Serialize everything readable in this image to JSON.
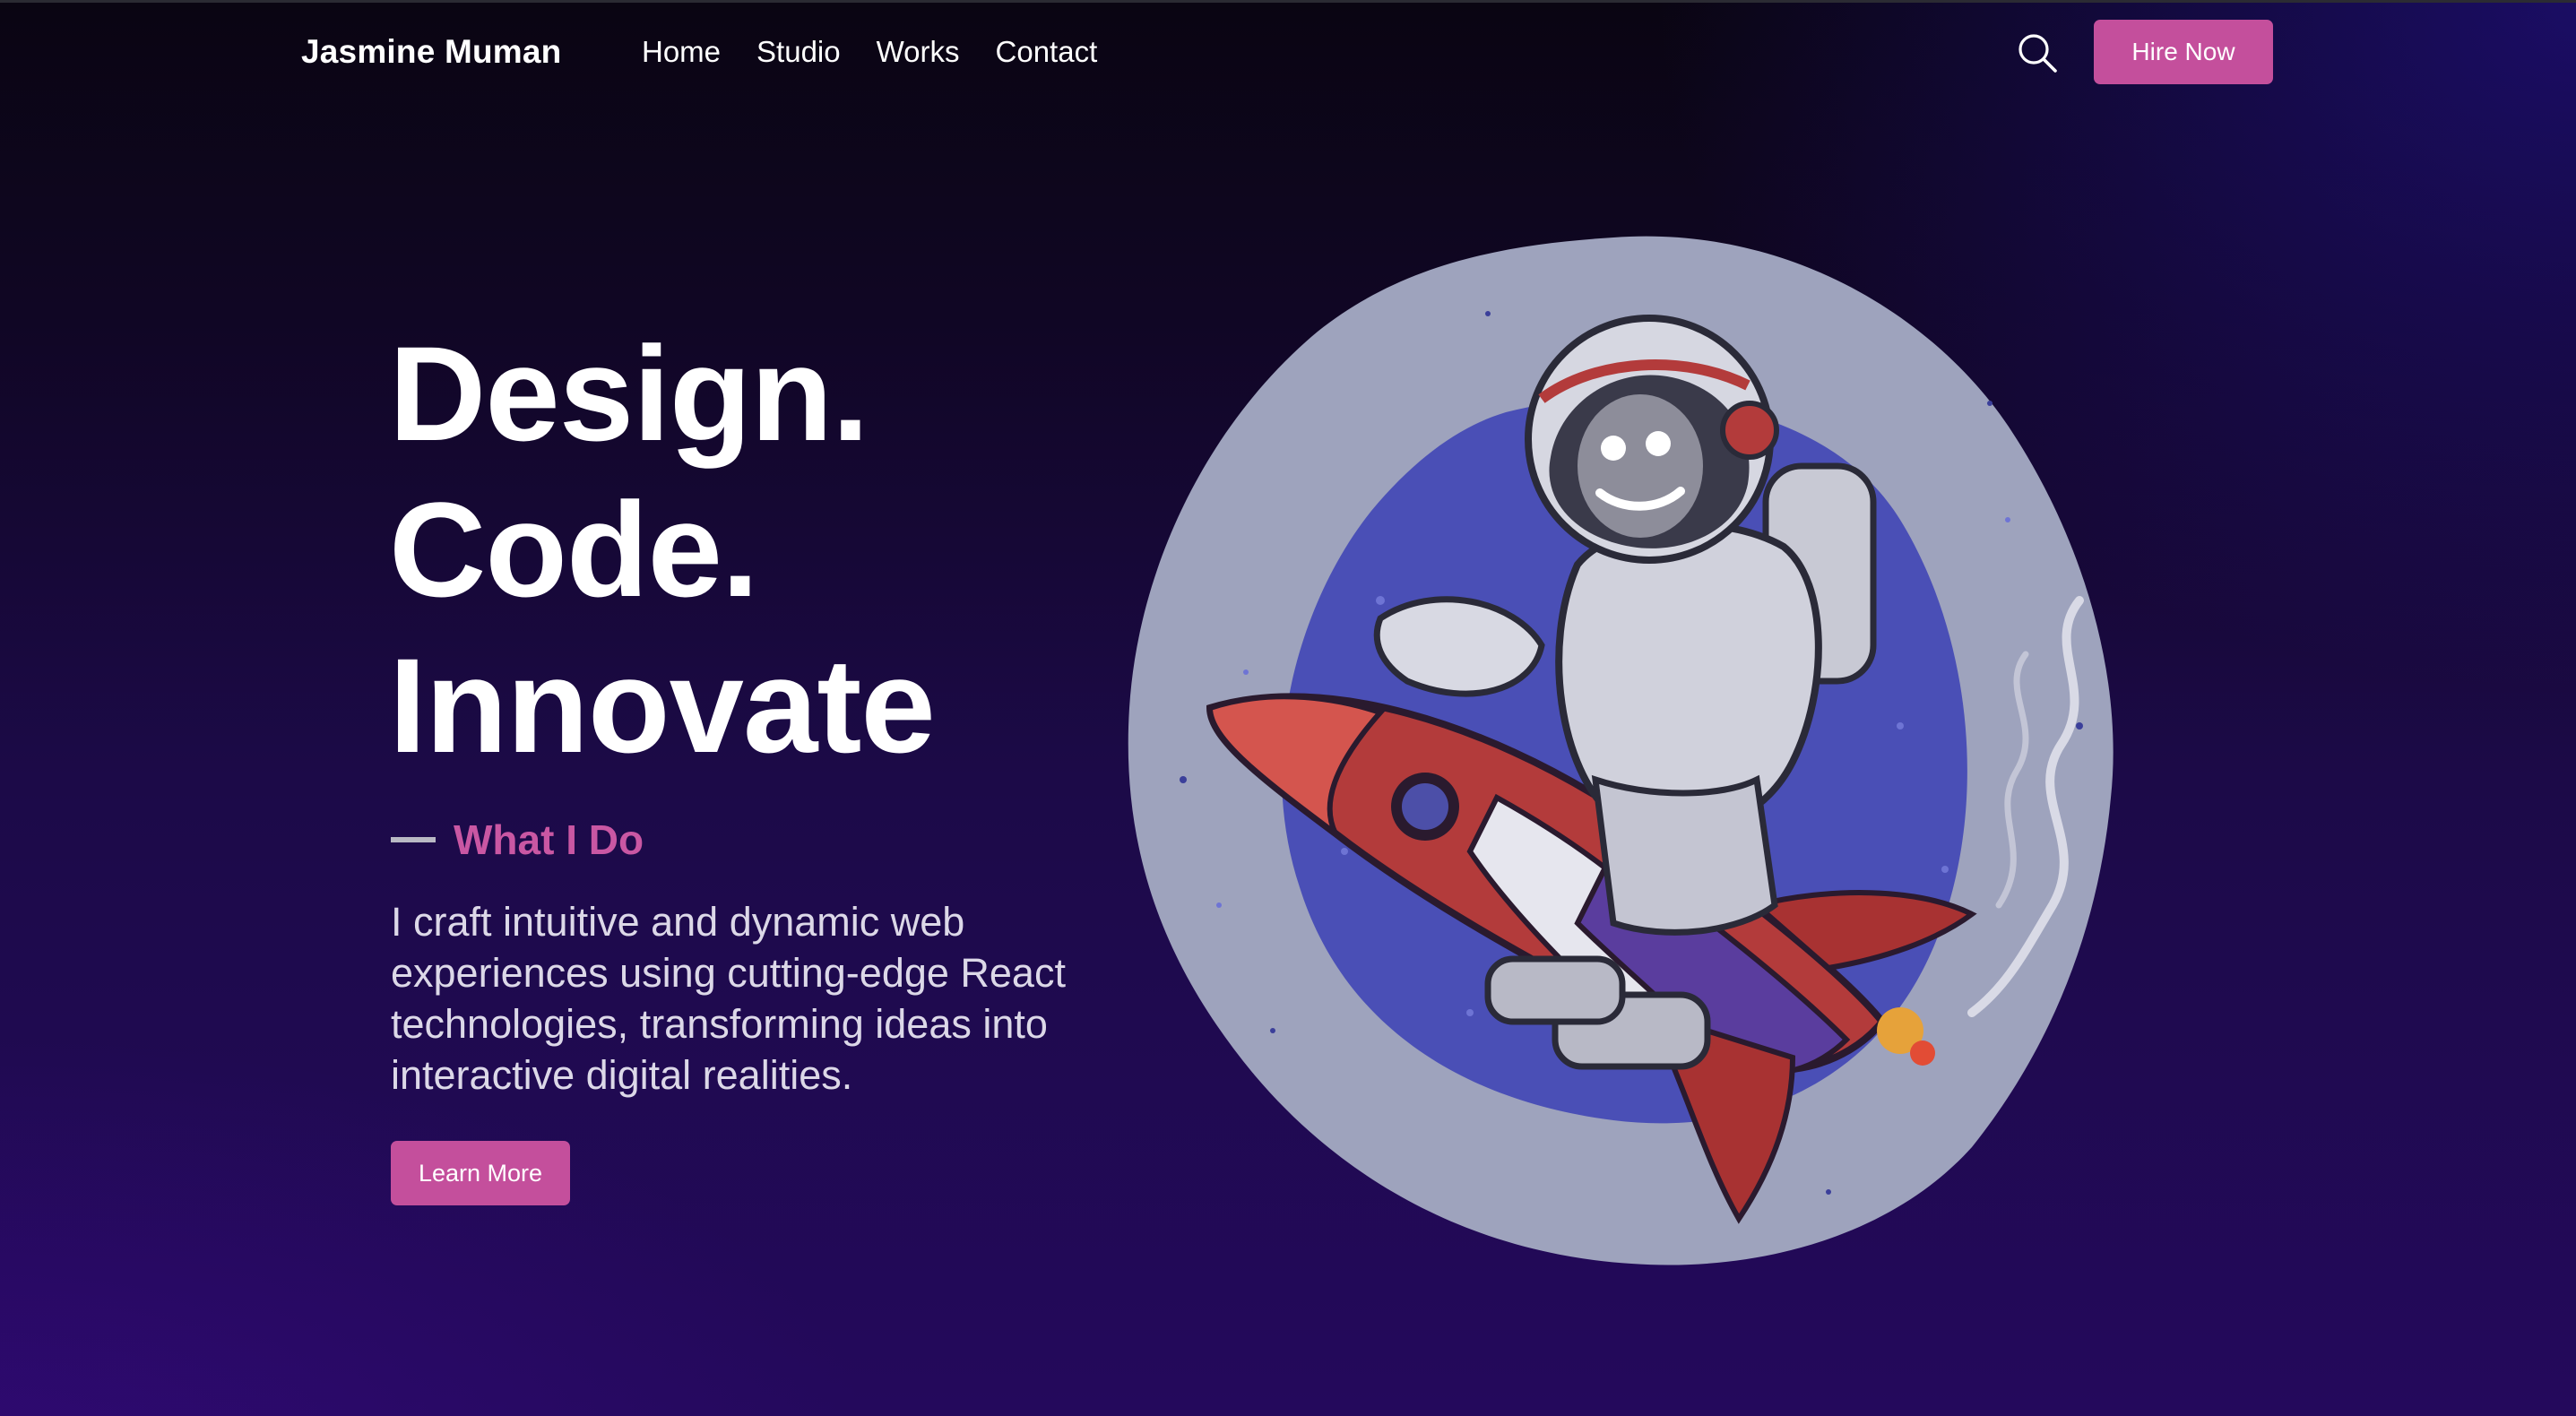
{
  "header": {
    "brand": "Jasmine Muman",
    "nav": [
      "Home",
      "Studio",
      "Works",
      "Contact"
    ],
    "search_icon": "search-icon",
    "hire_label": "Hire Now"
  },
  "hero": {
    "title_lines": [
      "Design.",
      "Code.",
      "Innovate"
    ],
    "section_label": "What I Do",
    "description": "I craft intuitive and dynamic web experiences using cutting-edge React technologies, transforming ideas into interactive digital realities.",
    "cta_label": "Learn More",
    "illustration": "astronaut-riding-rocket-illustration"
  },
  "colors": {
    "accent": "#c44f9c",
    "accent_text": "#c957a3",
    "background_dark": "#0a0512",
    "background_purple": "#24095c"
  }
}
